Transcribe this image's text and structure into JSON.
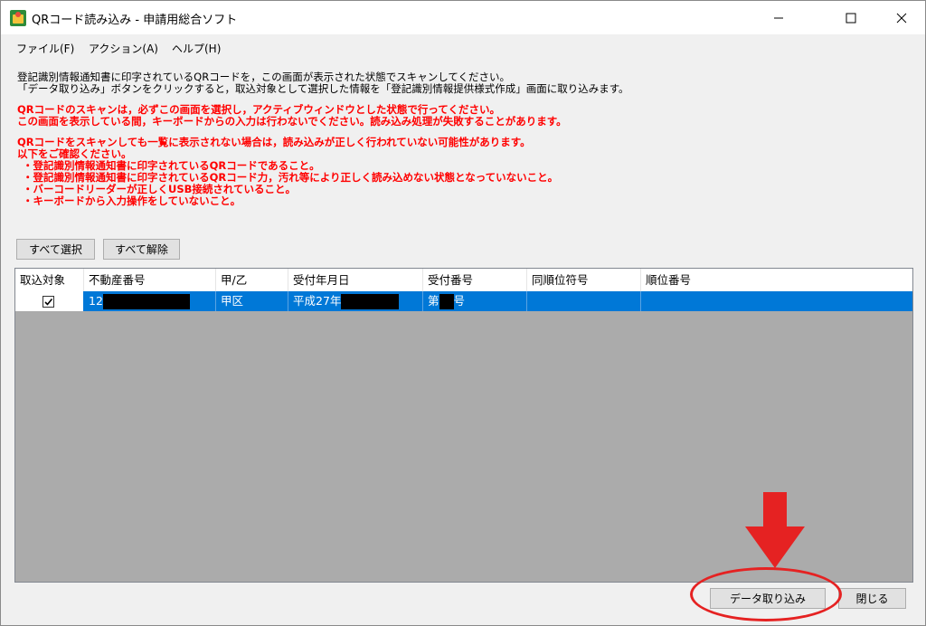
{
  "window": {
    "title": "QRコード読み込み - 申請用総合ソフト"
  },
  "menu": {
    "file": "ファイル(F)",
    "action": "アクション(A)",
    "help": "ヘルプ(H)"
  },
  "instructions": {
    "line1": "登記識別情報通知書に印字されているQRコードを，この画面が表示された状態でスキャンしてください。",
    "line2": "「データ取り込み」ボタンをクリックすると，取込対象として選択した情報を「登記識別情報提供様式作成」画面に取り込みます。",
    "warn1": "QRコードのスキャンは，必ずこの画面を選択し，アクティブウィンドウとした状態で行ってください。",
    "warn2": "この画面を表示している間，キーボードからの入力は行わないでください。読み込み処理が失敗することがあります。",
    "warn3": "QRコードをスキャンしても一覧に表示されない場合は，読み込みが正しく行われていない可能性があります。",
    "warn4": "以下をご確認ください。",
    "bullet1": "・登記識別情報通知書に印字されているQRコードであること。",
    "bullet2": "・登記識別情報通知書に印字されているQRコード力，汚れ等により正しく読み込めない状態となっていないこと。",
    "bullet3": "・バーコードリーダーが正しくUSB接続されていること。",
    "bullet4": "・キーボードから入力操作をしていないこと。"
  },
  "buttons": {
    "select_all": "すべて選択",
    "deselect_all": "すべて解除",
    "import": "データ取り込み",
    "close": "閉じる"
  },
  "table": {
    "headers": [
      "取込対象",
      "不動産番号",
      "甲/乙",
      "受付年月日",
      "受付番号",
      "同順位符号",
      "順位番号"
    ],
    "rows": [
      {
        "checked": true,
        "property_number": "12",
        "kou_otsu": "甲区",
        "date": "平成27年",
        "number_prefix": "第",
        "number_suffix": "号",
        "same_rank": "",
        "rank": ""
      }
    ]
  },
  "colors": {
    "selection": "#0078d7",
    "warning_text": "#ff0000",
    "annotation": "#e52222"
  }
}
